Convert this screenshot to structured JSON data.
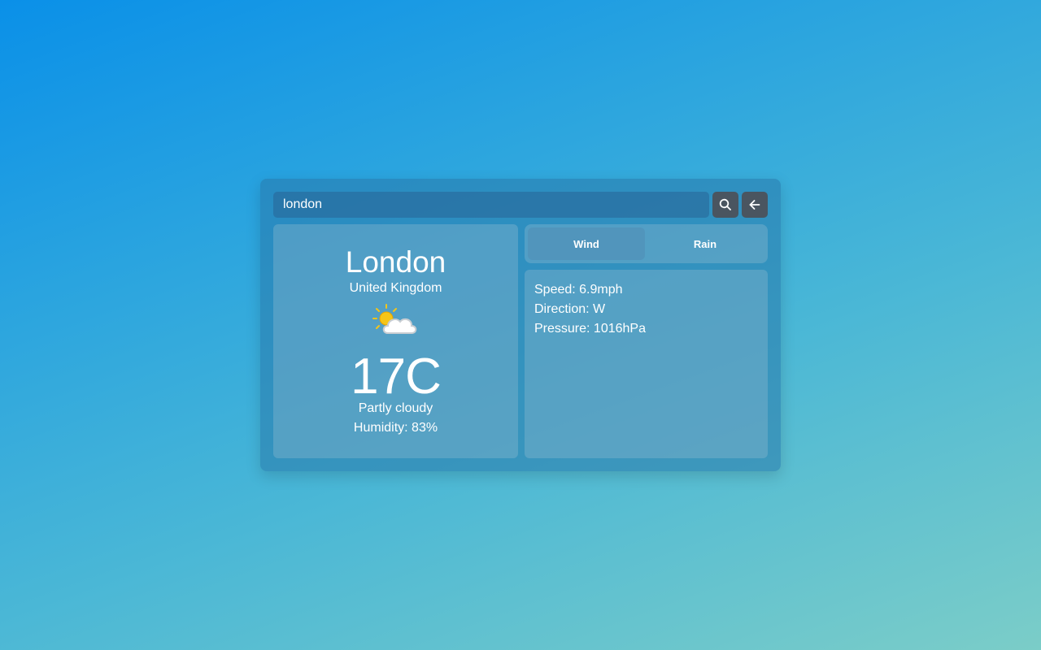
{
  "search": {
    "value": "london"
  },
  "icons": {
    "search_button": "search-icon",
    "back_button": "arrow-left-icon",
    "weather": "partly-cloudy-icon"
  },
  "weather": {
    "city": "London",
    "country": "United Kingdom",
    "temperature": "17C",
    "condition": "Partly cloudy",
    "humidity": "Humidity: 83%"
  },
  "tabs": [
    {
      "label": "Wind",
      "active": true
    },
    {
      "label": "Rain",
      "active": false
    }
  ],
  "details": {
    "speed": "Speed: 6.9mph",
    "direction": "Direction: W",
    "pressure": "Pressure: 1016hPa"
  },
  "colors": {
    "button_bg": "#4a5560",
    "text": "#ffffff",
    "sun": "#f5c518"
  }
}
